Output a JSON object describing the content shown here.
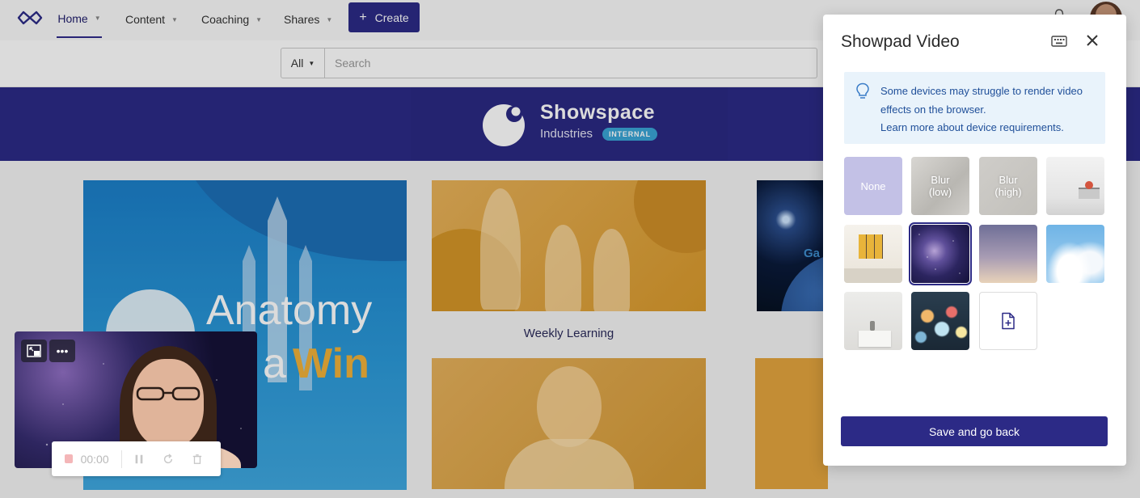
{
  "nav": {
    "items": [
      {
        "label": "Home"
      },
      {
        "label": "Content"
      },
      {
        "label": "Coaching"
      },
      {
        "label": "Shares"
      }
    ],
    "create_label": "Create",
    "icons": {
      "logo": "infinity-logo",
      "bell": "bell-icon",
      "avatar": "user-avatar"
    }
  },
  "search": {
    "scope": "All",
    "placeholder": "Search",
    "value": ""
  },
  "banner": {
    "brand_name": "Showspace",
    "brand_sub": "Industries",
    "badge": "INTERNAL"
  },
  "tiles": {
    "anatomy_line1": "Anatomy",
    "anatomy_line2a": "a",
    "anatomy_line2b": "Win",
    "weekly_caption": "Weekly Learning",
    "space_text": "Ga"
  },
  "recorder": {
    "time": "00:00"
  },
  "modal": {
    "title": "Showpad Video",
    "notice": "Some devices may struggle to render video effects on the browser.",
    "notice_link": "Learn more about device requirements.",
    "backgrounds": [
      {
        "label": "None"
      },
      {
        "label": "Blur\n(low)"
      },
      {
        "label": "Blur\n(high)"
      }
    ],
    "selected_background": "galaxy",
    "save_label": "Save and go back"
  },
  "colors": {
    "primary": "#2c2a86",
    "notice_bg": "#e9f3fb",
    "notice_text": "#1f4f99",
    "accent_orange": "#e6a83a"
  }
}
